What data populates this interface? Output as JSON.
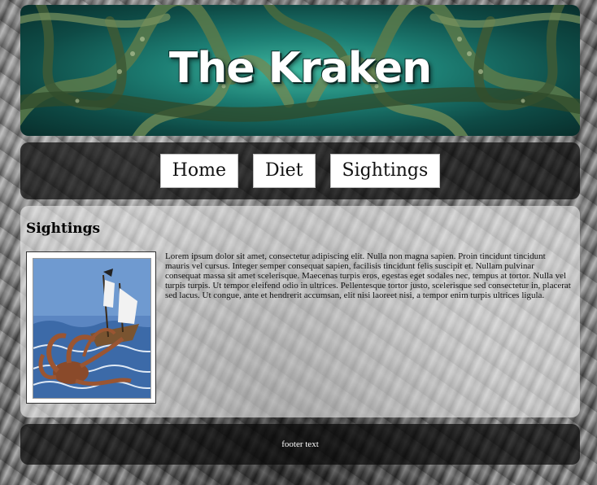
{
  "header": {
    "title": "The Kraken"
  },
  "nav": {
    "items": [
      {
        "label": "Home"
      },
      {
        "label": "Diet"
      },
      {
        "label": "Sightings"
      }
    ]
  },
  "main": {
    "heading": "Sightings",
    "image_subject": "kraken attacking sailing ship illustration",
    "paragraph": "Lorem ipsum dolor sit amet, consectetur adipiscing elit. Nulla non magna sapien. Proin tincidunt tincidunt mauris vel cursus. Integer semper consequat sapien, facilisis tincidunt felis suscipit et. Nullam pulvinar consequat massa sit amet scelerisque. Maecenas turpis eros, egestas eget sodales nec, tempus at tortor. Nulla vel turpis turpis. Ut tempor eleifend odio in ultrices. Pellentesque tortor justo, scelerisque sed consectetur in, placerat sed lacus. Ut congue, ante et hendrerit accumsan, elit nisi laoreet nisi, a tempor enim turpis ultrices ligula."
  },
  "footer": {
    "text": "footer text"
  },
  "colors": {
    "header_teal": "#1d7f74",
    "panel_dark": "#0a0a0a",
    "panel_light": "#ebebeb"
  }
}
